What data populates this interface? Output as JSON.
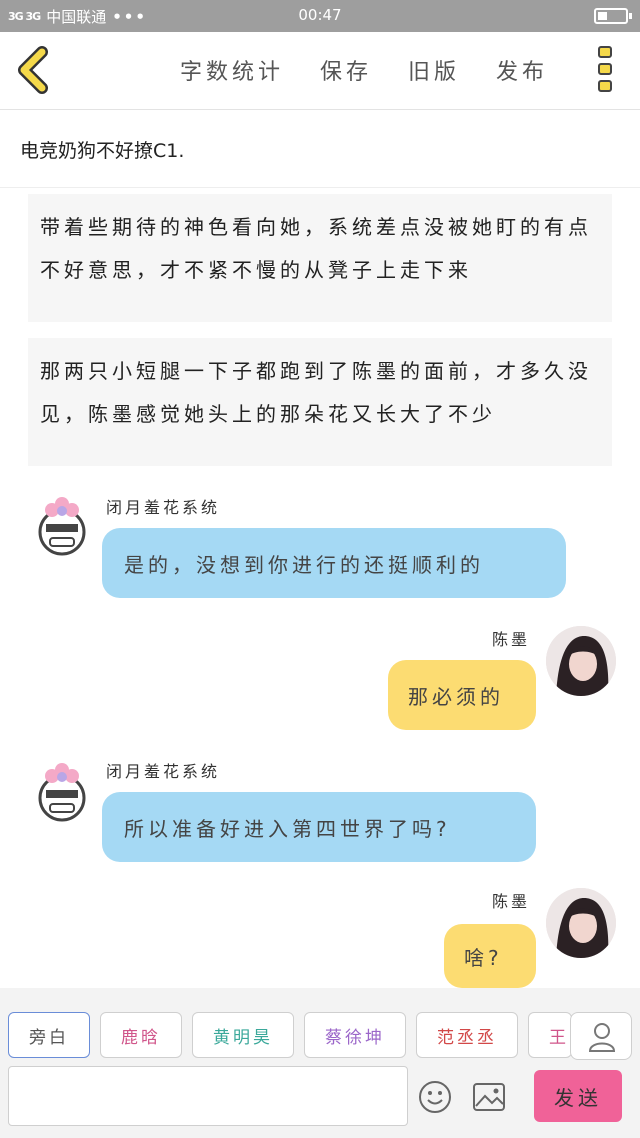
{
  "status_bar": {
    "carrier": "中国联通",
    "signal": "3G 3G",
    "dots": "•••",
    "time": "00:47"
  },
  "toolbar": {
    "word_count": "字数统计",
    "save": "保存",
    "old_version": "旧版",
    "publish": "发布"
  },
  "chapter_title": "电竞奶狗不好撩C1.",
  "narration": [
    "带着些期待的神色看向她，系统差点没被她盯的有点不好意思，才不紧不慢的从凳子上走下来",
    "那两只小短腿一下子都跑到了陈墨的面前，才多久没见，陈墨感觉她头上的那朵花又长大了不少"
  ],
  "messages": [
    {
      "speaker": "闭月羞花系统",
      "text": "是的，没想到你进行的还挺顺利的"
    },
    {
      "speaker": "陈墨",
      "text": "那必须的"
    },
    {
      "speaker": "闭月羞花系统",
      "text": "所以准备好进入第四世界了吗?"
    },
    {
      "speaker": "陈墨",
      "text": "啥?"
    }
  ],
  "character_tags": [
    {
      "label": "旁白",
      "color": "#555555"
    },
    {
      "label": "鹿晗",
      "color": "#d0558a"
    },
    {
      "label": "黄明昊",
      "color": "#3aa89a"
    },
    {
      "label": "蔡徐坤",
      "color": "#9b66c9"
    },
    {
      "label": "范丞丞",
      "color": "#d24848"
    },
    {
      "label": "王",
      "color": "#d0558a"
    }
  ],
  "input": {
    "placeholder": ""
  },
  "send_label": "发送",
  "colors": {
    "status_bar": "#9e9e9e",
    "back_arrow": "#f5d94a",
    "system_bubble": "#a5d9f4",
    "user_bubble": "#fcdc72",
    "send_button": "#f06298",
    "selected_tag_border": "#6a8dd8"
  },
  "icons": [
    "back-arrow-icon",
    "more-menu-icon",
    "person-icon",
    "emoji-icon",
    "image-icon",
    "battery-icon",
    "signal-icon"
  ]
}
